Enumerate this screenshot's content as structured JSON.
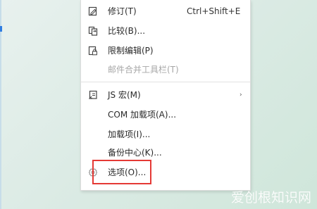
{
  "menu": {
    "items": [
      {
        "label": "修订(T)",
        "shortcut": "Ctrl+Shift+E",
        "icon": "edit-document-icon"
      },
      {
        "label": "比较(B)...",
        "icon": "compare-icon"
      },
      {
        "label": "限制编辑(P)",
        "icon": "lock-document-icon"
      },
      {
        "label": "邮件合并工具栏(T)",
        "disabled": true
      },
      {
        "label": "JS 宏(M)",
        "icon": "macro-icon",
        "submenu_arrow": "›"
      },
      {
        "label": "COM 加载项(A)..."
      },
      {
        "label": "加载项(I)..."
      },
      {
        "label": "备份中心(K)..."
      },
      {
        "label": "选项(O)...",
        "icon": "gear-icon"
      }
    ]
  },
  "watermark": {
    "text": "爱创根知识网"
  },
  "colors": {
    "highlight": "#e53935",
    "background": "#dcebe5"
  }
}
